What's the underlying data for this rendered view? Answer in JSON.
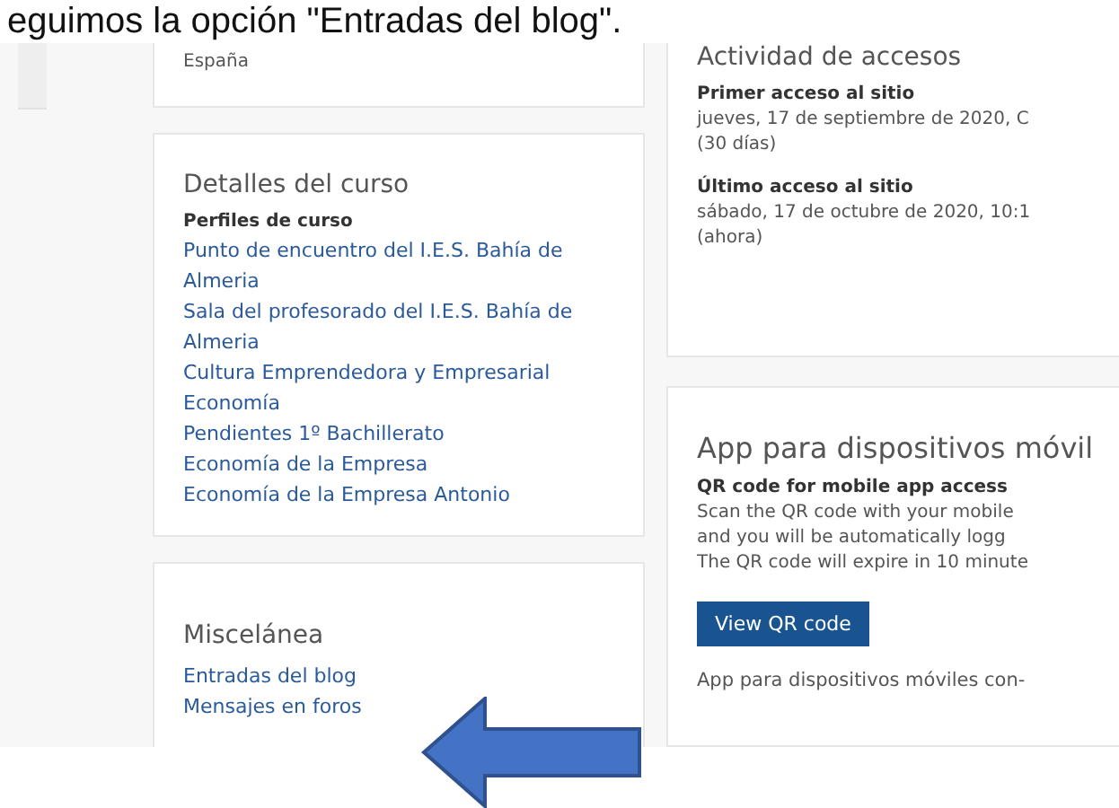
{
  "caption": "eguimos la opción \"Entradas del blog\".",
  "left_cards": [
    {
      "lines": [
        {
          "kind": "text",
          "text": "España"
        }
      ]
    },
    {
      "title": "Detalles del curso",
      "lines": [
        {
          "kind": "label",
          "text": "Perfiles de curso"
        },
        {
          "kind": "link",
          "text": "Punto de encuentro del I.E.S. Bahía de Almeria"
        },
        {
          "kind": "link",
          "text": "Sala del profesorado del I.E.S. Bahía de Almeria"
        },
        {
          "kind": "link",
          "text": "Cultura Emprendedora y Empresarial"
        },
        {
          "kind": "link",
          "text": "Economía"
        },
        {
          "kind": "link",
          "text": "Pendientes 1º Bachillerato"
        },
        {
          "kind": "link",
          "text": "Economía de la Empresa"
        },
        {
          "kind": "link",
          "text": "Economía de la Empresa Antonio"
        }
      ]
    },
    {
      "title": "Miscelánea",
      "lines": [
        {
          "kind": "link",
          "text": "Entradas del blog"
        },
        {
          "kind": "link",
          "text": "Mensajes en foros"
        }
      ]
    }
  ],
  "access_card": {
    "title": "Actividad de accesos",
    "items": [
      {
        "label": "Primer acceso al sitio",
        "value": "jueves, 17 de septiembre de 2020, C",
        "note": "(30 días)"
      },
      {
        "label": "Último acceso al sitio",
        "value": "sábado, 17 de octubre de 2020, 10:1",
        "note": "(ahora)"
      }
    ]
  },
  "app_card": {
    "title": "App para dispositivos móvil",
    "label": "QR code for mobile app access",
    "lines": [
      "Scan the QR code with your mobile",
      "and you will be automatically logg",
      "The QR code will expire in 10 minute"
    ],
    "button": "View QR code",
    "footer": "App para dispositivos móviles con-"
  }
}
